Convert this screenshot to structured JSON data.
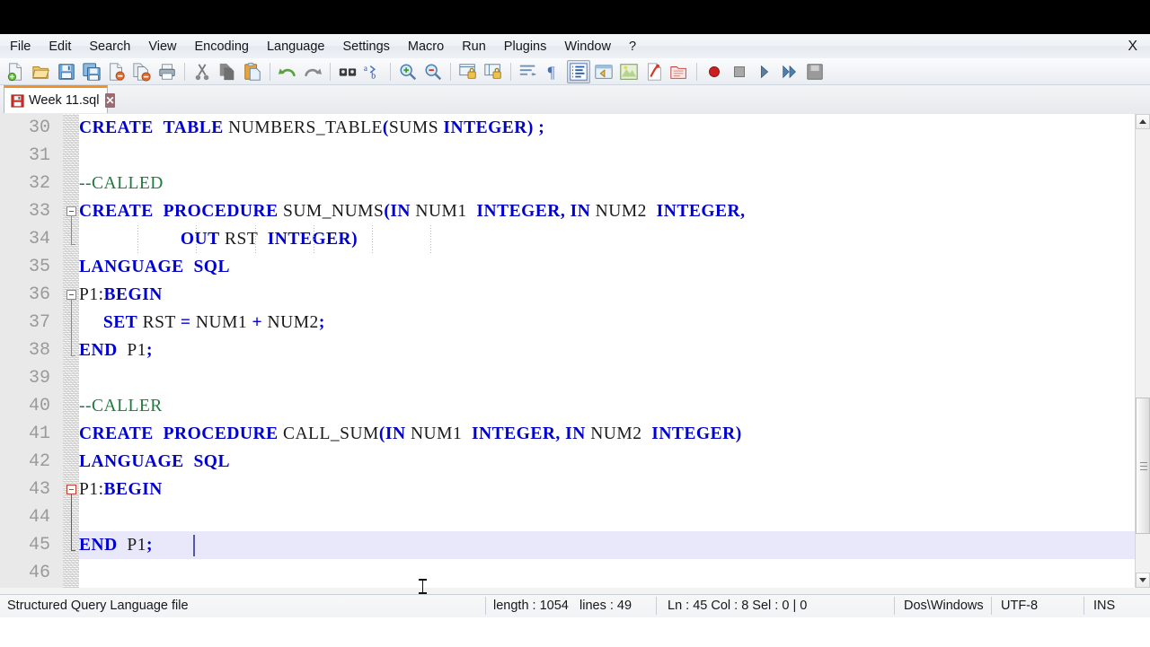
{
  "window": {
    "close_label": "X"
  },
  "menubar": {
    "items": [
      {
        "label": "File",
        "name": "menu-file"
      },
      {
        "label": "Edit",
        "name": "menu-edit"
      },
      {
        "label": "Search",
        "name": "menu-search"
      },
      {
        "label": "View",
        "name": "menu-view"
      },
      {
        "label": "Encoding",
        "name": "menu-encoding"
      },
      {
        "label": "Language",
        "name": "menu-language"
      },
      {
        "label": "Settings",
        "name": "menu-settings"
      },
      {
        "label": "Macro",
        "name": "menu-macro"
      },
      {
        "label": "Run",
        "name": "menu-run"
      },
      {
        "label": "Plugins",
        "name": "menu-plugins"
      },
      {
        "label": "Window",
        "name": "menu-window"
      },
      {
        "label": "?",
        "name": "menu-help"
      }
    ]
  },
  "toolbar": {
    "buttons": [
      {
        "name": "new-file-icon",
        "title": "New"
      },
      {
        "name": "open-file-icon",
        "title": "Open"
      },
      {
        "name": "save-icon",
        "title": "Save"
      },
      {
        "name": "save-all-icon",
        "title": "Save All"
      },
      {
        "name": "close-file-icon",
        "title": "Close"
      },
      {
        "name": "close-all-icon",
        "title": "Close All"
      },
      {
        "name": "print-icon",
        "title": "Print"
      },
      {
        "name": "separator",
        "title": ""
      },
      {
        "name": "cut-icon",
        "title": "Cut"
      },
      {
        "name": "copy-icon",
        "title": "Copy"
      },
      {
        "name": "paste-icon",
        "title": "Paste"
      },
      {
        "name": "separator",
        "title": ""
      },
      {
        "name": "undo-icon",
        "title": "Undo"
      },
      {
        "name": "redo-icon",
        "title": "Redo"
      },
      {
        "name": "separator",
        "title": ""
      },
      {
        "name": "find-icon",
        "title": "Find"
      },
      {
        "name": "replace-icon",
        "title": "Replace"
      },
      {
        "name": "separator",
        "title": ""
      },
      {
        "name": "zoom-in-icon",
        "title": "Zoom In"
      },
      {
        "name": "zoom-out-icon",
        "title": "Zoom Out"
      },
      {
        "name": "separator",
        "title": ""
      },
      {
        "name": "sync-vertical-icon",
        "title": "Synchronize Vertical Scrolling"
      },
      {
        "name": "sync-horizontal-icon",
        "title": "Synchronize Horizontal Scrolling"
      },
      {
        "name": "separator",
        "title": ""
      },
      {
        "name": "word-wrap-icon",
        "title": "Word Wrap"
      },
      {
        "name": "show-all-chars-icon",
        "title": "Show All Characters"
      },
      {
        "name": "indent-guide-icon",
        "title": "Show Indent Guide"
      },
      {
        "name": "user-define-dialog-icon",
        "title": "User Defined Dialogue"
      },
      {
        "name": "document-map-icon",
        "title": "Document Map"
      },
      {
        "name": "function-list-icon",
        "title": "Function List"
      },
      {
        "name": "folder-workspace-icon",
        "title": "Folder as Workspace"
      },
      {
        "name": "separator",
        "title": ""
      },
      {
        "name": "record-macro-icon",
        "title": "Start Recording"
      },
      {
        "name": "stop-macro-icon",
        "title": "Stop Recording"
      },
      {
        "name": "play-macro-icon",
        "title": "Play Macro"
      },
      {
        "name": "run-macro-multiple-icon",
        "title": "Run Macro Multiple Times"
      },
      {
        "name": "save-macro-icon",
        "title": "Save Current Macro"
      }
    ]
  },
  "tab": {
    "label": "Week 11.sql",
    "close_label": "✕",
    "modified": false
  },
  "editor": {
    "first_visible_line": 30,
    "current_line": 45,
    "lines": [
      {
        "number": "30",
        "tokens": [
          {
            "t": "CREATE",
            "c": "kw"
          },
          {
            "t": "  ",
            "c": "id"
          },
          {
            "t": "TABLE",
            "c": "kw"
          },
          {
            "t": " NUMBERS_TABLE",
            "c": "id"
          },
          {
            "t": "(",
            "c": "op"
          },
          {
            "t": "SUMS ",
            "c": "id"
          },
          {
            "t": "INTEGER",
            "c": "kw"
          },
          {
            "t": ")",
            "c": "op"
          },
          {
            "t": " ",
            "c": "id"
          },
          {
            "t": ";",
            "c": "op"
          }
        ]
      },
      {
        "number": "31",
        "tokens": []
      },
      {
        "number": "32",
        "tokens": [
          {
            "t": "--CALLED",
            "c": "cm"
          }
        ]
      },
      {
        "number": "33",
        "tokens": [
          {
            "t": "CREATE",
            "c": "kw"
          },
          {
            "t": "  ",
            "c": "id"
          },
          {
            "t": "PROCEDURE",
            "c": "kw"
          },
          {
            "t": " SUM_NUMS",
            "c": "id"
          },
          {
            "t": "(",
            "c": "op"
          },
          {
            "t": "IN",
            "c": "kw"
          },
          {
            "t": " NUM1  ",
            "c": "id"
          },
          {
            "t": "INTEGER",
            "c": "kw"
          },
          {
            "t": ",",
            "c": "op"
          },
          {
            "t": " ",
            "c": "id"
          },
          {
            "t": "IN",
            "c": "kw"
          },
          {
            "t": " NUM2  ",
            "c": "id"
          },
          {
            "t": "INTEGER",
            "c": "kw"
          },
          {
            "t": ",",
            "c": "op"
          }
        ]
      },
      {
        "number": "34",
        "indent_spaces": 21,
        "tokens": [
          {
            "t": "                     ",
            "c": "id"
          },
          {
            "t": "OUT",
            "c": "kw"
          },
          {
            "t": " RST  ",
            "c": "id"
          },
          {
            "t": "INTEGER",
            "c": "kw"
          },
          {
            "t": ")",
            "c": "op"
          }
        ]
      },
      {
        "number": "35",
        "tokens": [
          {
            "t": "LANGUAGE",
            "c": "kw"
          },
          {
            "t": "  ",
            "c": "id"
          },
          {
            "t": "SQL",
            "c": "kw"
          }
        ]
      },
      {
        "number": "36",
        "tokens": [
          {
            "t": "P1",
            "c": "id"
          },
          {
            "t": ":",
            "c": "id"
          },
          {
            "t": "BEGIN",
            "c": "kw"
          }
        ]
      },
      {
        "number": "37",
        "tokens": [
          {
            "t": "     ",
            "c": "id"
          },
          {
            "t": "SET",
            "c": "kw"
          },
          {
            "t": " RST ",
            "c": "id"
          },
          {
            "t": "=",
            "c": "op"
          },
          {
            "t": " NUM1 ",
            "c": "id"
          },
          {
            "t": "+",
            "c": "op"
          },
          {
            "t": " NUM2",
            "c": "id"
          },
          {
            "t": ";",
            "c": "op"
          }
        ]
      },
      {
        "number": "38",
        "tokens": [
          {
            "t": "END",
            "c": "kw"
          },
          {
            "t": "  P1",
            "c": "id"
          },
          {
            "t": ";",
            "c": "op"
          }
        ]
      },
      {
        "number": "39",
        "tokens": []
      },
      {
        "number": "40",
        "tokens": [
          {
            "t": "--CALLER",
            "c": "cm"
          }
        ]
      },
      {
        "number": "41",
        "tokens": [
          {
            "t": "CREATE",
            "c": "kw"
          },
          {
            "t": "  ",
            "c": "id"
          },
          {
            "t": "PROCEDURE",
            "c": "kw"
          },
          {
            "t": " CALL_SUM",
            "c": "id"
          },
          {
            "t": "(",
            "c": "op"
          },
          {
            "t": "IN",
            "c": "kw"
          },
          {
            "t": " NUM1  ",
            "c": "id"
          },
          {
            "t": "INTEGER",
            "c": "kw"
          },
          {
            "t": ",",
            "c": "op"
          },
          {
            "t": " ",
            "c": "id"
          },
          {
            "t": "IN",
            "c": "kw"
          },
          {
            "t": " NUM2  ",
            "c": "id"
          },
          {
            "t": "INTEGER",
            "c": "kw"
          },
          {
            "t": ")",
            "c": "op"
          }
        ]
      },
      {
        "number": "42",
        "tokens": [
          {
            "t": "LANGUAGE",
            "c": "kw"
          },
          {
            "t": "  ",
            "c": "id"
          },
          {
            "t": "SQL",
            "c": "kw"
          }
        ]
      },
      {
        "number": "43",
        "tokens": [
          {
            "t": "P1",
            "c": "id"
          },
          {
            "t": ":",
            "c": "id"
          },
          {
            "t": "BEGIN",
            "c": "kw"
          }
        ]
      },
      {
        "number": "44",
        "tokens": []
      },
      {
        "number": "45",
        "tokens": [
          {
            "t": "END",
            "c": "kw"
          },
          {
            "t": "  P1",
            "c": "id"
          },
          {
            "t": ";",
            "c": "op"
          }
        ]
      },
      {
        "number": "46",
        "tokens": []
      }
    ]
  },
  "statusbar": {
    "file_type": "Structured Query Language file",
    "length": "length : 1054",
    "lines": "lines : 49",
    "position": "Ln : 45    Col : 8    Sel : 0 | 0",
    "eol": "Dos\\Windows",
    "encoding": "UTF-8",
    "insert_mode": "INS"
  },
  "colors": {
    "keyword": "#0000d0",
    "comment": "#1d7a3c",
    "identifier": "#1a1a1a",
    "current_line_bg": "#e8e8fa",
    "gutter_bg": "#e9e9e9",
    "tab_accent": "#f0922b",
    "fold_active": "#c0392b"
  }
}
